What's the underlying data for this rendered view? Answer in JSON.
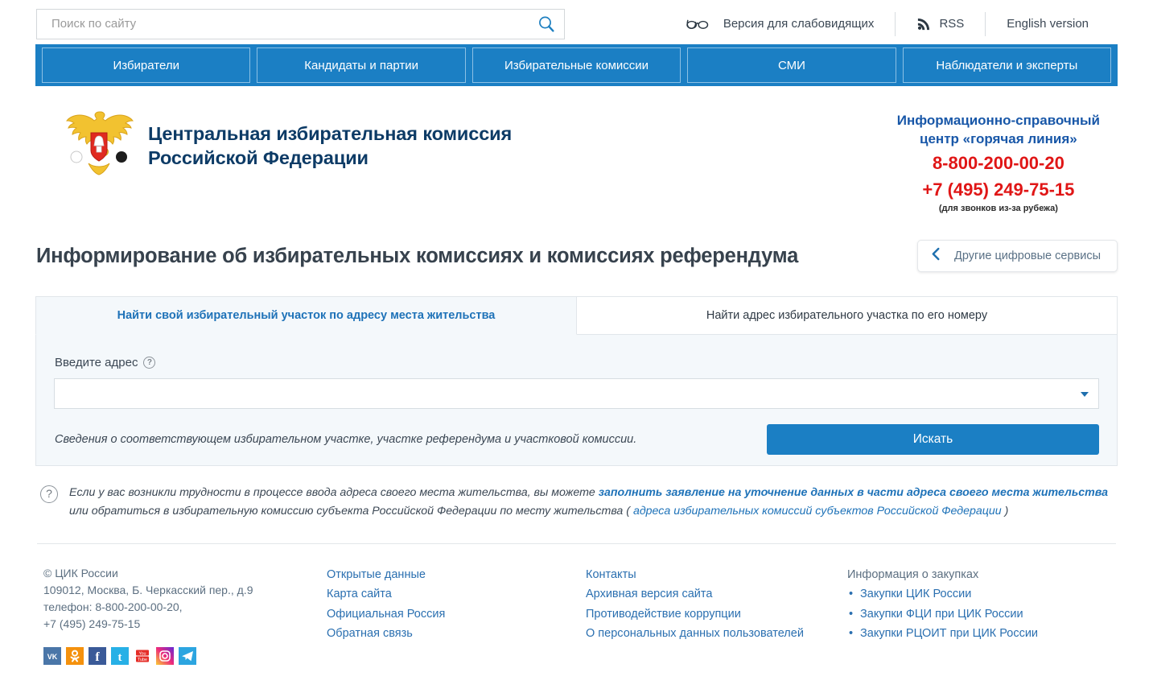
{
  "search": {
    "placeholder": "Поиск по сайту",
    "value": "",
    "icon": "search-icon"
  },
  "topbar": {
    "links": [
      {
        "label": "Версия для слабовидящих",
        "icon": "glasses-icon"
      },
      {
        "label": "RSS",
        "icon": "rss-icon"
      },
      {
        "label": "English version",
        "icon": ""
      }
    ]
  },
  "nav": {
    "items": [
      {
        "label": "Избиратели"
      },
      {
        "label": "Кандидаты и партии"
      },
      {
        "label": "Избирательные комиссии"
      },
      {
        "label": "СМИ"
      },
      {
        "label": "Наблюдатели и эксперты"
      }
    ]
  },
  "header": {
    "org_name_line1": "Центральная избирательная комиссия",
    "org_name_line2": "Российской Федерации",
    "emblem_icon": "russian-coat-of-arms-icon",
    "hotline_title_line1": "Информационно-справочный",
    "hotline_title_line2": "центр «горячая линия»",
    "phone_1": "8-800-200-00-20",
    "phone_2": "+7 (495) 249-75-15",
    "phone_note": "(для звонков из-за рубежа)"
  },
  "main": {
    "page_title": "Информирование об избирательных комиссиях и комиссиях референдума",
    "services_button": "Другие цифровые сервисы",
    "tabs": [
      {
        "label": "Найти свой избирательный участок по адресу места жительства",
        "active": true
      },
      {
        "label": "Найти адрес избирательного участка по его номеру",
        "active": false
      }
    ],
    "form": {
      "field_label": "Введите адрес",
      "address_value": "",
      "hint": "Сведения о соответствующем избирательном участке, участке референдума и участковой комиссии.",
      "submit_label": "Искать"
    },
    "notice": {
      "part1": "Если у вас возникли трудности в процессе ввода адреса своего места жительства, вы можете ",
      "link1": "заполнить заявление на уточнение данных в части адреса своего места жительства",
      "part2": " или обратиться в избирательную комиссию субъекта Российской Федерации по месту жительства ( ",
      "link2": "адреса избирательных комиссий субъектов Российской Федерации",
      "part3": " )"
    }
  },
  "footer": {
    "copyright": "© ЦИК России",
    "address": "109012, Москва, Б. Черкасский пер., д.9",
    "phone_line1": "телефон: 8-800-200-00-20,",
    "phone_line2": "+7 (495) 249-75-15",
    "socials": [
      {
        "name": "vk-icon",
        "label": "VK"
      },
      {
        "name": "odnoklassniki-icon",
        "label": "OK"
      },
      {
        "name": "facebook-icon",
        "label": "f"
      },
      {
        "name": "twitter-icon",
        "label": "t"
      },
      {
        "name": "youtube-icon",
        "label": "YouTube"
      },
      {
        "name": "instagram-icon",
        "label": "Instagram"
      },
      {
        "name": "telegram-icon",
        "label": "Telegram"
      }
    ],
    "col_a": [
      "Открытые данные",
      "Карта сайта",
      "Официальная Россия",
      "Обратная связь"
    ],
    "col_b": [
      "Контакты",
      "Архивная версия сайта",
      "Противодействие коррупции",
      "О персональных данных пользователей"
    ],
    "col_c_head": "Информация о закупках",
    "col_c": [
      "Закупки ЦИК России",
      "Закупки ФЦИ при ЦИК России",
      "Закупки РЦОИТ при ЦИК России"
    ]
  },
  "colors": {
    "brand_blue": "#1b7fc4",
    "link_blue": "#2a6fb0",
    "title_navy": "#0d3b66",
    "red": "#e01616",
    "panel_bg": "#f4f8fb"
  }
}
